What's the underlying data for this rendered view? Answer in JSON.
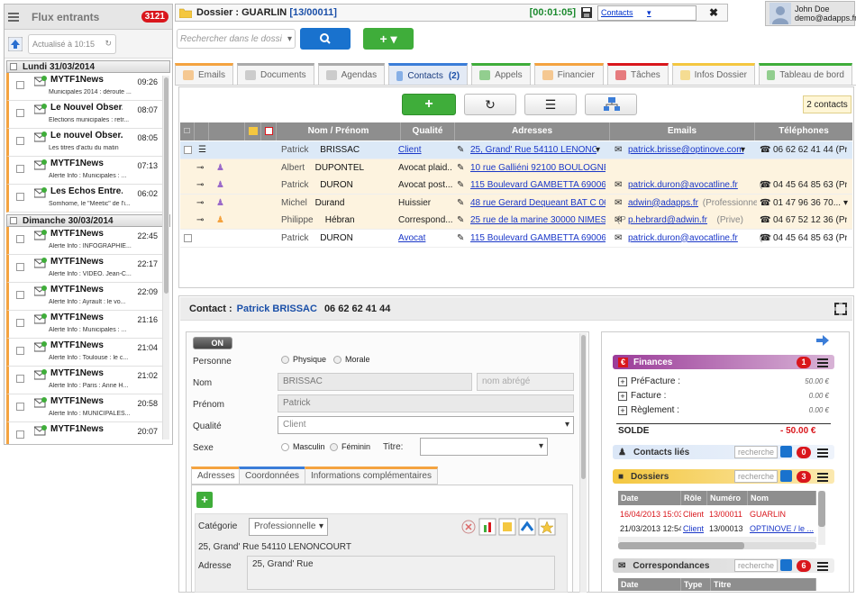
{
  "left": {
    "title": "Flux entrants",
    "badge": "3121",
    "refresh": "Actualisé à 10:15",
    "days": [
      {
        "label": "Lundi 31/03/2014",
        "items": [
          {
            "src": "MYTF1News",
            "time": "09:26",
            "sub": "Municipales 2014 : déroute ..."
          },
          {
            "src": "Le Nouvel Obser...",
            "time": "08:07",
            "sub": "Elections municipales : retr..."
          },
          {
            "src": "Le nouvel Obser...",
            "time": "08:05",
            "sub": "Les titres d'actu du matin"
          },
          {
            "src": "MYTF1News",
            "time": "07:13",
            "sub": "Alerte Info : Municipales : ..."
          },
          {
            "src": "Les Echos Entre...",
            "time": "06:02",
            "sub": "Somhome, le \"Meetic\" de l'i..."
          }
        ]
      },
      {
        "label": "Dimanche 30/03/2014",
        "items": [
          {
            "src": "MYTF1News",
            "time": "22:45",
            "sub": "Alerte Info : INFOGRAPHIE..."
          },
          {
            "src": "MYTF1News",
            "time": "22:17",
            "sub": "Alerte Info : VIDEO. Jean-C..."
          },
          {
            "src": "MYTF1News",
            "time": "22:09",
            "sub": "Alerte Info : Ayrault : le vo..."
          },
          {
            "src": "MYTF1News",
            "time": "21:16",
            "sub": "Alerte Info : Municipales : ..."
          },
          {
            "src": "MYTF1News",
            "time": "21:04",
            "sub": "Alerte Info : Toulouse : le c..."
          },
          {
            "src": "MYTF1News",
            "time": "21:02",
            "sub": "Alerte Info : Paris : Anne H..."
          },
          {
            "src": "MYTF1News",
            "time": "20:58",
            "sub": "Alerte Info : MUNICIPALES..."
          },
          {
            "src": "MYTF1News",
            "time": "20:07",
            "sub": ""
          }
        ]
      }
    ]
  },
  "topbar": {
    "label": "Dossier : GUARLIN",
    "code": "[13/00011]",
    "timer": "[00:01:05]",
    "select": "Contacts"
  },
  "user": {
    "name": "John Doe",
    "email": "demo@adapps.fr"
  },
  "search": {
    "placeholder": "Rechercher dans le dossi"
  },
  "tabs": [
    {
      "label": "Emails",
      "color": "#f4a340"
    },
    {
      "label": "Documents",
      "color": "#aaaaaa"
    },
    {
      "label": "Agendas",
      "color": "#aaaaaa"
    },
    {
      "label": "Contacts",
      "count": "(2)",
      "color": "#3b7dd8"
    },
    {
      "label": "Appels",
      "color": "#3fad3a"
    },
    {
      "label": "Financier",
      "color": "#f4a340"
    },
    {
      "label": "Tâches",
      "color": "#d9161c"
    },
    {
      "label": "Infos Dossier",
      "color": "#f4c740"
    },
    {
      "label": "Tableau de bord",
      "color": "#3fad3a"
    }
  ],
  "contacts": {
    "count": "2 contacts",
    "headers": {
      "name": "Nom / Prénom",
      "quality": "Qualité",
      "address": "Adresses",
      "emails": "Emails",
      "phones": "Téléphones"
    },
    "rows": [
      {
        "first": "Patrick",
        "last": "BRISSAC",
        "quality": "Client",
        "address": "25, Grand' Rue 54110 LENONCOURT",
        "email": "patrick.brisse@optinove.com",
        "phone": "06 62 62 41 44 (Pr"
      },
      {
        "first": "Albert",
        "last": "DUPONTEL",
        "quality": "Avocat plaid...",
        "address": "10 rue Galliéni 92100 BOULOGNE",
        "email": "",
        "phone": ""
      },
      {
        "first": "Patrick",
        "last": "DURON",
        "quality": "Avocat post...",
        "address": "115 Boulevard GAMBETTA 69006 LY...",
        "email": "patrick.duron@avocatline.fr",
        "emailnote": "(Pr",
        "phone": "04 45 64 85 63 (Pr"
      },
      {
        "first": "Michel",
        "last": "Durand",
        "quality": "Huissier",
        "address": "48 rue Gerard Dequeant BAT C 060...",
        "email": "adwin@adapps.fr",
        "emailnote": "(Professionnel)",
        "phone": "01 47 96 36 70..."
      },
      {
        "first": "Philippe",
        "last": "Hébran",
        "quality": "Correspond...",
        "address": "25 rue de la marine 30000 NIMES",
        "addressnote": "(P",
        "email": "p.hebrard@adwin.fr",
        "emailnote": "(Prive)",
        "phone": "04 67 52 12 36 (Pr"
      },
      {
        "first": "Patrick",
        "last": "DURON",
        "quality": "Avocat",
        "address": "115 Boulevard GAMBETTA 69006 LY...",
        "email": "patrick.duron@avocatline.fr",
        "emailnote": "(Pr",
        "phone": "04 45 64 85 63 (Pr"
      }
    ]
  },
  "detail": {
    "label": "Contact :",
    "name": "Patrick BRISSAC",
    "phone": "06 62 62 41 44",
    "toggle": "ON",
    "labels": {
      "personne": "Personne",
      "nom": "Nom",
      "prenom": "Prénom",
      "qualite": "Qualité",
      "sexe": "Sexe",
      "titre": "Titre:",
      "categorie": "Catégorie",
      "adresse": "Adresse"
    },
    "radio_person": [
      "Physique",
      "Morale"
    ],
    "radio_sex": [
      "Masculin",
      "Féminin"
    ],
    "nom": "BRISSAC",
    "nom_abrege": "nom abrégé",
    "prenom": "Patrick",
    "qualite": "Client",
    "subtabs": [
      "Adresses",
      "Coordonnées",
      "Informations complémentaires"
    ],
    "categorie": "Professionnelle",
    "address_line": "25, Grand' Rue 54110 LENONCOURT",
    "adresse": "25, Grand' Rue"
  },
  "right": {
    "finances": {
      "title": "Finances",
      "badge": "1",
      "rows": [
        [
          "PréFacture :",
          "50.00 €"
        ],
        [
          "Facture :",
          "0.00 €"
        ],
        [
          "Règlement :",
          "0.00 €"
        ]
      ],
      "solde_label": "SOLDE",
      "solde": "- 50.00 €"
    },
    "contacts_lies": {
      "title": "Contacts liés",
      "search": "recherche",
      "badge": "0"
    },
    "dossiers": {
      "title": "Dossiers",
      "search": "recherche",
      "badge": "3",
      "headers": [
        "Date",
        "Rôle",
        "Numéro",
        "Nom"
      ],
      "rows": [
        [
          "16/04/2013 15:03",
          "Client",
          "13/00011",
          "GUARLIN"
        ],
        [
          "21/03/2013 12:54",
          "Client",
          "13/00013",
          "OPTINOVE / le ..."
        ]
      ]
    },
    "correspondances": {
      "title": "Correspondances",
      "search": "recherche",
      "badge": "6",
      "headers": [
        "Date",
        "Type",
        "Titre"
      ]
    }
  }
}
